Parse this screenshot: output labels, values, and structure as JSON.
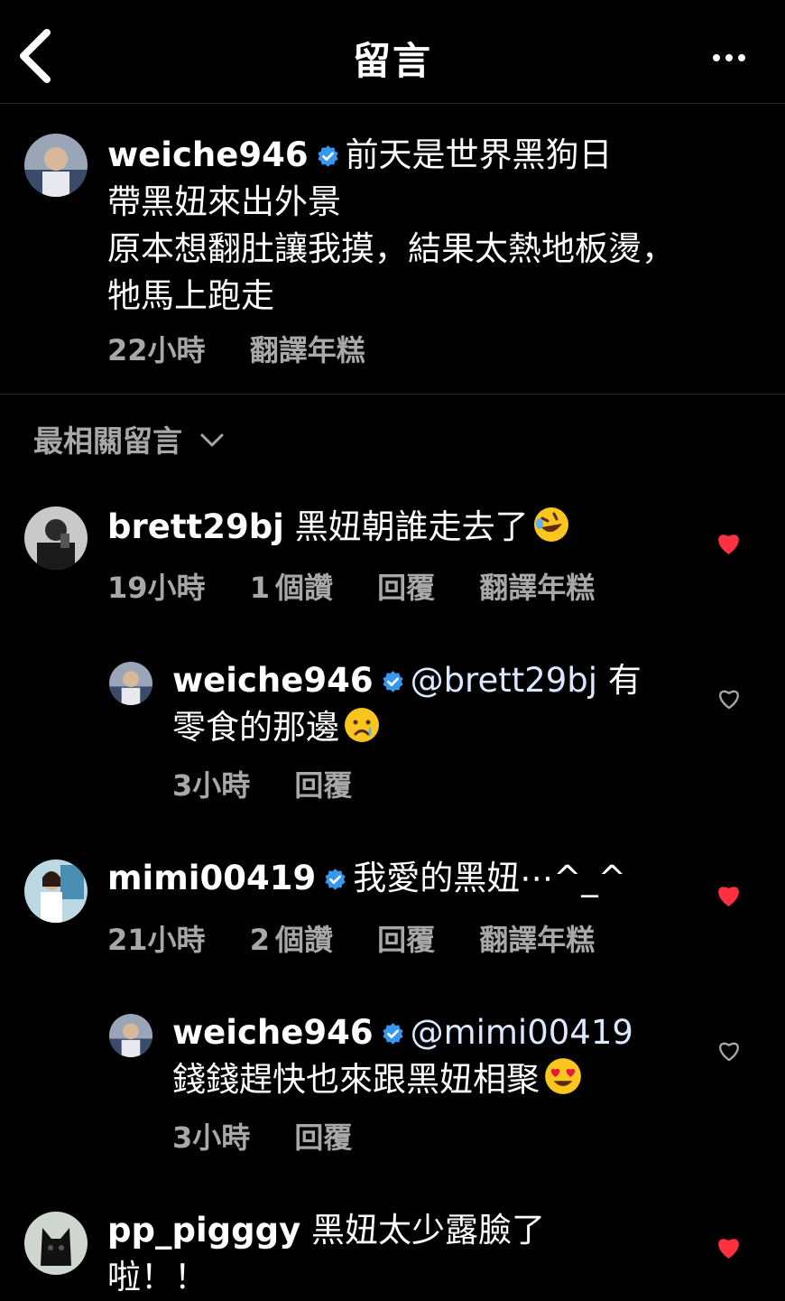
{
  "header": {
    "title": "留言"
  },
  "post": {
    "username": "weiche946",
    "lines": [
      "前天是世界黑狗日",
      "帶黑妞來出外景",
      "原本想翻肚讓我摸，結果太熱地板燙，",
      "牠馬上跑走"
    ],
    "time": "22小時",
    "translate": "翻譯年糕"
  },
  "sort": {
    "label": "最相關留言"
  },
  "comments": [
    {
      "username": "brett29bj",
      "text": "黑妞朝誰走去了",
      "emoji": "rolling-on-floor-laughing",
      "time": "19小時",
      "likes": "1",
      "likes_suffix": "個讚",
      "reply": "回覆",
      "translate": "翻譯年糕",
      "liked": true
    },
    {
      "username": "weiche946",
      "mention": "@brett29bj",
      "text_tail": "有",
      "text2": "零食的那邊",
      "emoji": "crying-face",
      "time": "3小時",
      "reply": "回覆",
      "liked": false
    },
    {
      "username": "mimi00419",
      "text": "我愛的黑妞⋯^_^",
      "time": "21小時",
      "likes": "2",
      "likes_suffix": "個讚",
      "reply": "回覆",
      "translate": "翻譯年糕",
      "liked": true
    },
    {
      "username": "weiche946",
      "mention": "@mimi00419",
      "text2": "錢錢趕快也來跟黑妞相聚",
      "emoji": "heart-eyes",
      "time": "3小時",
      "reply": "回覆",
      "liked": false
    },
    {
      "username": "pp_pigggy",
      "text": "黑妞太少露臉了",
      "text2": "啦！！",
      "liked": true
    }
  ],
  "colors": {
    "background": "#000000",
    "meta": "#a8a8a8",
    "verified": "#3897f0",
    "heart": "#ff3040",
    "divider": "#262626"
  }
}
